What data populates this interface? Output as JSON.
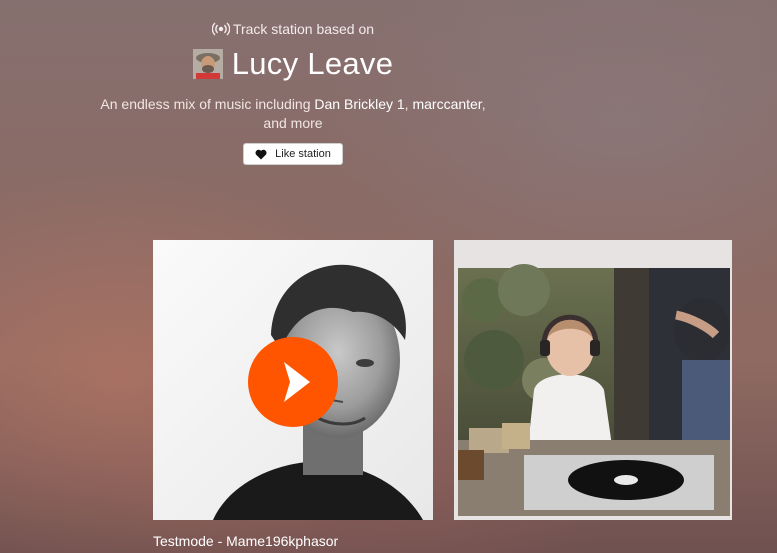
{
  "header": {
    "eyebrow_text": "Track station based on",
    "title": "Lucy Leave",
    "description_prefix": "An endless mix of music including",
    "artists": [
      "Dan Brickley 1",
      "marccanter"
    ],
    "description_suffix": "and more",
    "like_label": "Like station"
  },
  "tracks": [
    {
      "title": "Testmode - Mame196kphasor",
      "artwork": "grayscale-portrait-of-man",
      "playing_control": "play-icon"
    },
    {
      "title": "",
      "artwork": "child-dj-with-headphones-at-turntable"
    }
  ],
  "colors": {
    "accent": "#ff5500",
    "text": "#ffffff",
    "button_bg": "#ffffff"
  },
  "icons": {
    "eyebrow": "radio-broadcast-icon",
    "like": "heart-icon",
    "play": "play-icon"
  }
}
